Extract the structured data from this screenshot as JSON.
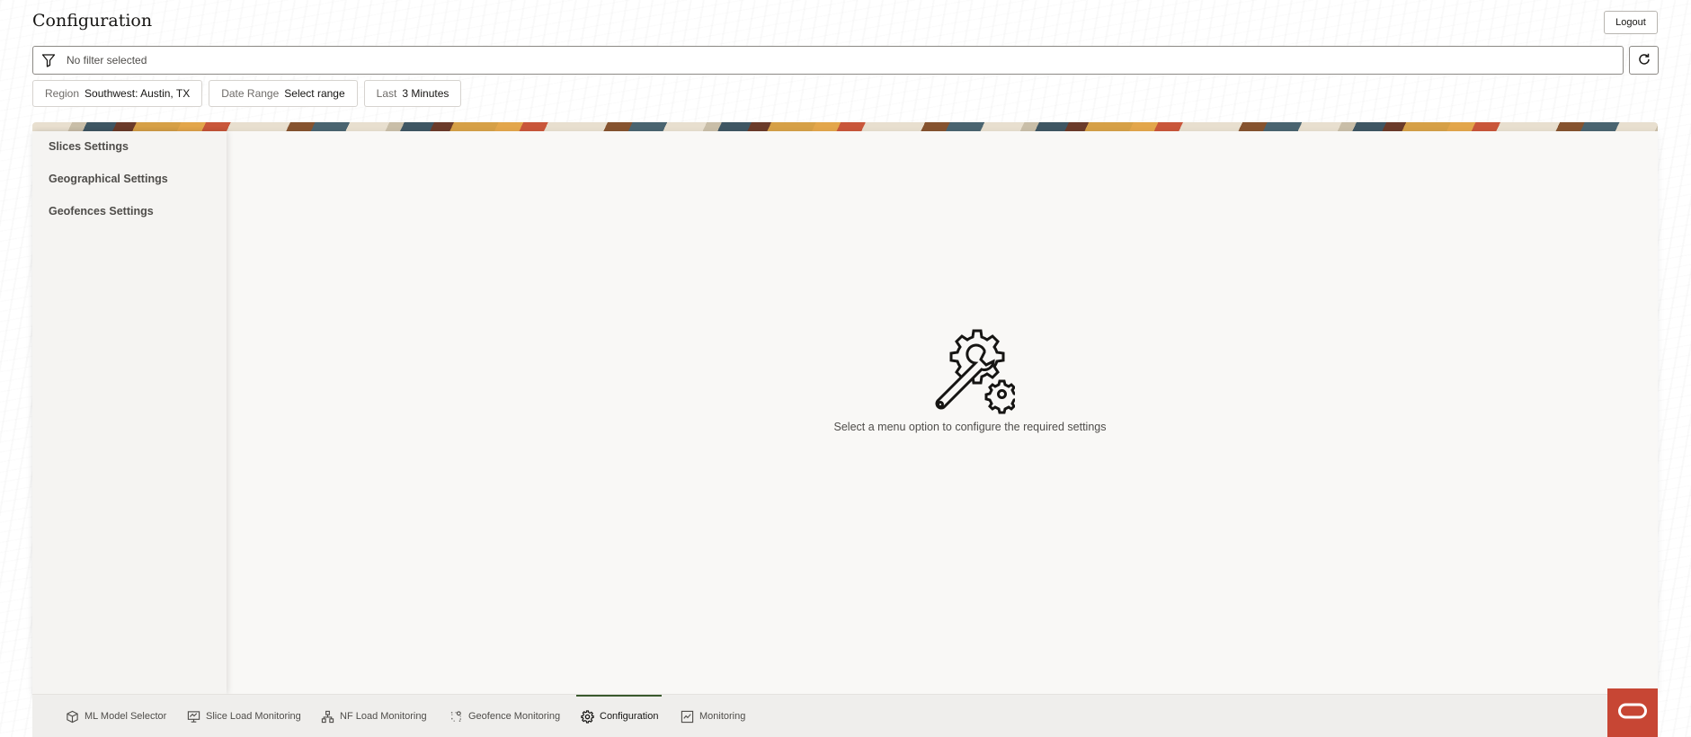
{
  "header": {
    "title": "Configuration",
    "logout_label": "Logout"
  },
  "filter": {
    "placeholder_text": "No filter selected"
  },
  "chips": [
    {
      "key": "Region",
      "value": "Southwest: Austin, TX"
    },
    {
      "key": "Date Range",
      "value": "Select range"
    },
    {
      "key": "Last",
      "value": "3 Minutes"
    }
  ],
  "sidebar": {
    "items": [
      {
        "label": "Slices Settings"
      },
      {
        "label": "Geographical Settings"
      },
      {
        "label": "Geofences Settings"
      }
    ]
  },
  "empty_state": {
    "icon": "wrench-gear-icon",
    "message": "Select a menu option to configure the required settings"
  },
  "tabs": [
    {
      "label": "ML Model Selector",
      "icon": "cube-icon",
      "active": false
    },
    {
      "label": "Slice Load Monitoring",
      "icon": "monitor-chart-icon",
      "active": false
    },
    {
      "label": "NF Load Monitoring",
      "icon": "network-icon",
      "active": false
    },
    {
      "label": "Geofence Monitoring",
      "icon": "geofence-icon",
      "active": false
    },
    {
      "label": "Configuration",
      "icon": "gear-icon",
      "active": true
    },
    {
      "label": "Monitoring",
      "icon": "chart-box-icon",
      "active": false
    }
  ],
  "colors": {
    "accent": "#3a5a2e",
    "brand": "#c74634",
    "text": "#161513"
  }
}
